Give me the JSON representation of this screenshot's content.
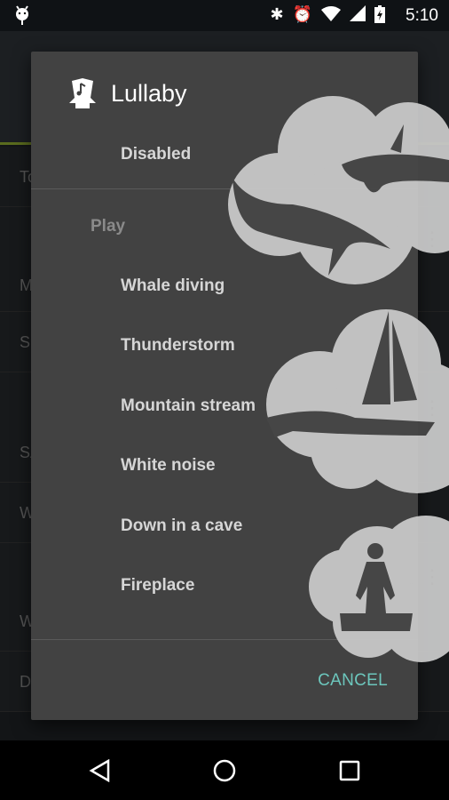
{
  "status_bar": {
    "time": "5:10",
    "icons": [
      "android-notification-icon",
      "bluetooth-icon",
      "alarm-icon",
      "wifi-icon",
      "signal-icon",
      "battery-charging-icon"
    ]
  },
  "background": {
    "fragments": [
      "To",
      "M",
      "S",
      "SA",
      "W",
      "W",
      "D"
    ]
  },
  "dialog": {
    "title": "Lullaby",
    "icon": "lullaby-music-box-icon",
    "disabled_label": "Disabled",
    "section_label": "Play",
    "items": [
      "Whale diving",
      "Thunderstorm",
      "Mountain stream",
      "White noise",
      "Down in a cave",
      "Fireplace"
    ],
    "cancel_label": "CANCEL"
  },
  "colors": {
    "dialog_bg": "#424242",
    "accent": "#6cc6bc",
    "cloud": "#c8c8c8"
  }
}
